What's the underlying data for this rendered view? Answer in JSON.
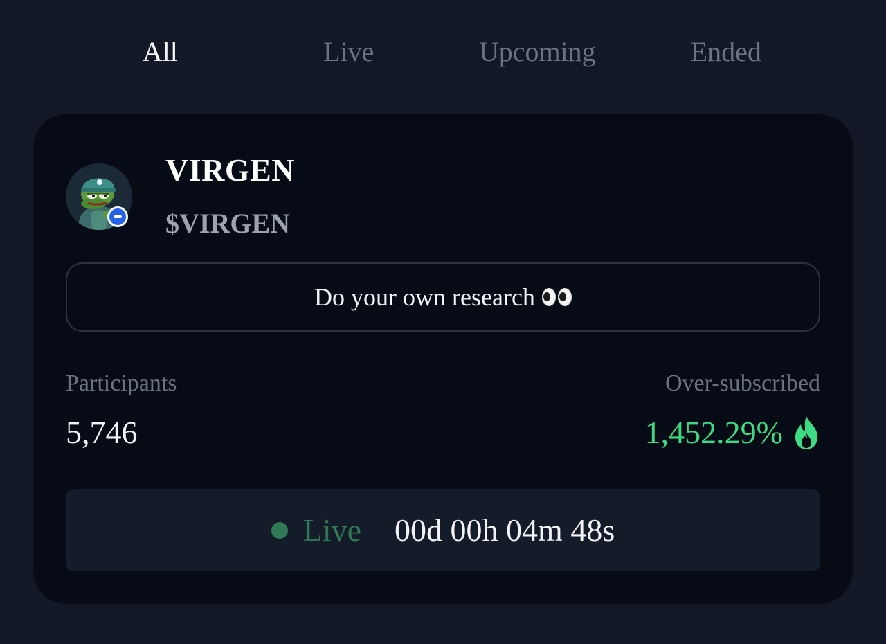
{
  "tabs": [
    {
      "label": "All",
      "active": true
    },
    {
      "label": "Live",
      "active": false
    },
    {
      "label": "Upcoming",
      "active": false
    },
    {
      "label": "Ended",
      "active": false
    }
  ],
  "project": {
    "name": "VIRGEN",
    "ticker": "$VIRGEN",
    "avatar_icon": "pepe-frog-avatar-icon",
    "chain_badge_icon": "chain-badge-icon"
  },
  "notice": {
    "text": "Do your own research",
    "icon": "eyes-emoji-icon"
  },
  "stats": {
    "participants_label": "Participants",
    "participants_value": "5,746",
    "oversubscribed_label": "Over-subscribed",
    "oversubscribed_value": "1,452.29%",
    "oversubscribed_icon": "flame-icon"
  },
  "status": {
    "label": "Live",
    "countdown": "00d 00h 04m 48s"
  },
  "colors": {
    "page_bg": "#121826",
    "card_bg": "#060b16",
    "accent_green": "#3ddc84",
    "live_green": "#2f7a55",
    "muted_text": "#6b7280"
  }
}
